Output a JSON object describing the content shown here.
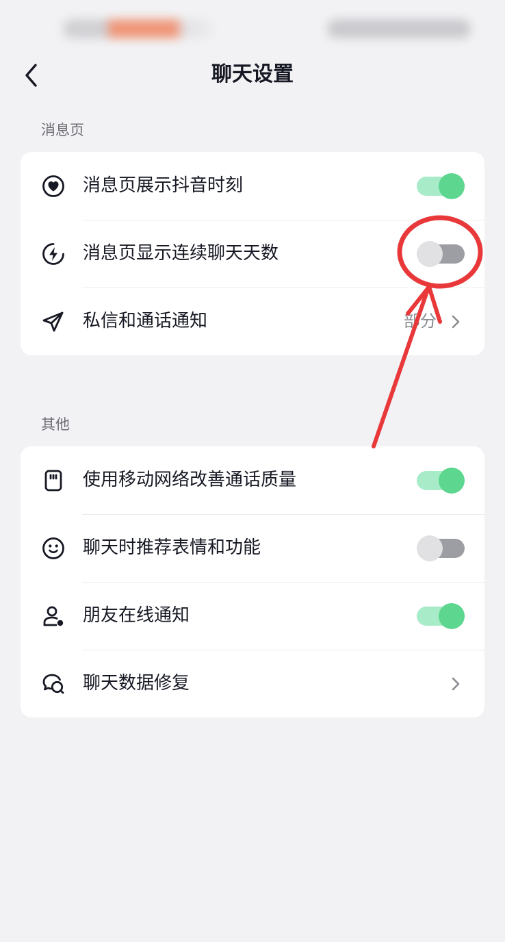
{
  "header": {
    "title": "聊天设置"
  },
  "sections": [
    {
      "label": "消息页",
      "items": [
        {
          "label": "消息页展示抖音时刻",
          "icon": "heart-circle-icon",
          "control": "toggle",
          "on": true
        },
        {
          "label": "消息页显示连续聊天天数",
          "icon": "lightning-circle-icon",
          "control": "toggle",
          "on": false
        },
        {
          "label": "私信和通话通知",
          "icon": "paper-plane-icon",
          "control": "link",
          "value": "部分"
        }
      ]
    },
    {
      "label": "其他",
      "items": [
        {
          "label": "使用移动网络改善通话质量",
          "icon": "sim-card-icon",
          "control": "toggle",
          "on": true
        },
        {
          "label": "聊天时推荐表情和功能",
          "icon": "smiley-face-icon",
          "control": "toggle",
          "on": false
        },
        {
          "label": "朋友在线通知",
          "icon": "user-online-icon",
          "control": "toggle",
          "on": true
        },
        {
          "label": "聊天数据修复",
          "icon": "chat-bubbles-icon",
          "control": "link"
        }
      ]
    }
  ],
  "colors": {
    "toggle_on_knob": "#5dd68f",
    "toggle_on_track": "#a8ebc9",
    "toggle_off_knob": "#e1e1e3",
    "toggle_off_track": "#9d9ea3",
    "annotation_red": "#e8383a",
    "background": "#f2f2f4"
  }
}
